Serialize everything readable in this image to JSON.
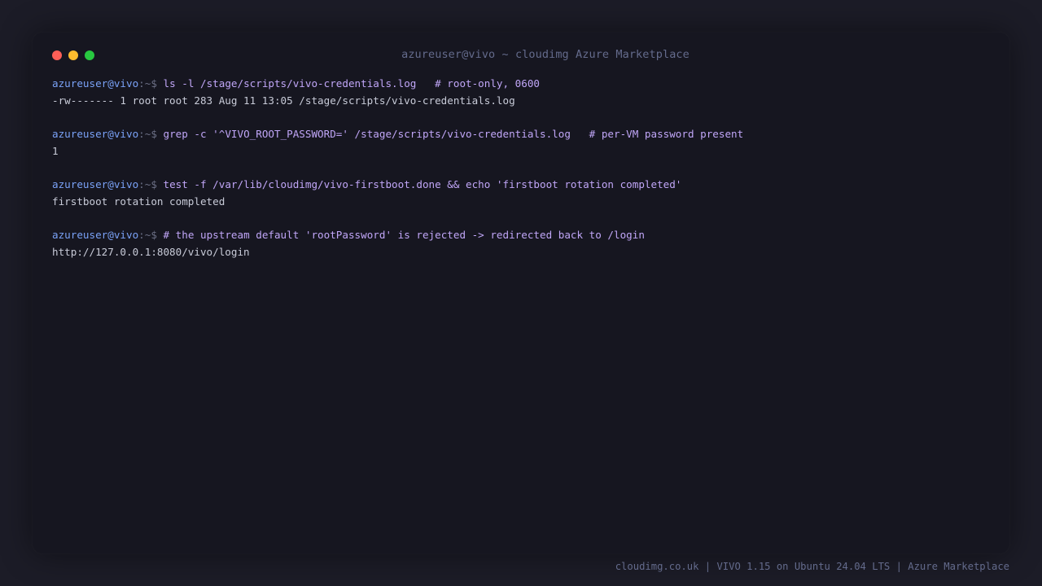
{
  "window": {
    "title": "azureuser@vivo ~ cloudimg Azure Marketplace",
    "traffic_lights": {
      "close_color": "#ff5f57",
      "minimize_color": "#febc2e",
      "maximize_color": "#28c840"
    }
  },
  "prompt": {
    "user_host": "azureuser@vivo",
    "path": ":~$ "
  },
  "colors": {
    "prompt_user": "#7aa2f7",
    "command": "#c0a6f7",
    "output": "#c8cbd8",
    "muted": "#646b8c"
  },
  "terminal": {
    "blocks": [
      {
        "command": "ls -l /stage/scripts/vivo-credentials.log   # root-only, 0600",
        "output": "-rw------- 1 root root 283 Aug 11 13:05 /stage/scripts/vivo-credentials.log"
      },
      {
        "command": "grep -c '^VIVO_ROOT_PASSWORD=' /stage/scripts/vivo-credentials.log   # per-VM password present",
        "output": "1"
      },
      {
        "command": "test -f /var/lib/cloudimg/vivo-firstboot.done && echo 'firstboot rotation completed'",
        "output": "firstboot rotation completed"
      },
      {
        "command": "# the upstream default 'rootPassword' is rejected -> redirected back to /login",
        "output": "http://127.0.0.1:8080/vivo/login"
      }
    ]
  },
  "footer": {
    "text": "cloudimg.co.uk | VIVO 1.15 on Ubuntu 24.04 LTS | Azure Marketplace"
  }
}
